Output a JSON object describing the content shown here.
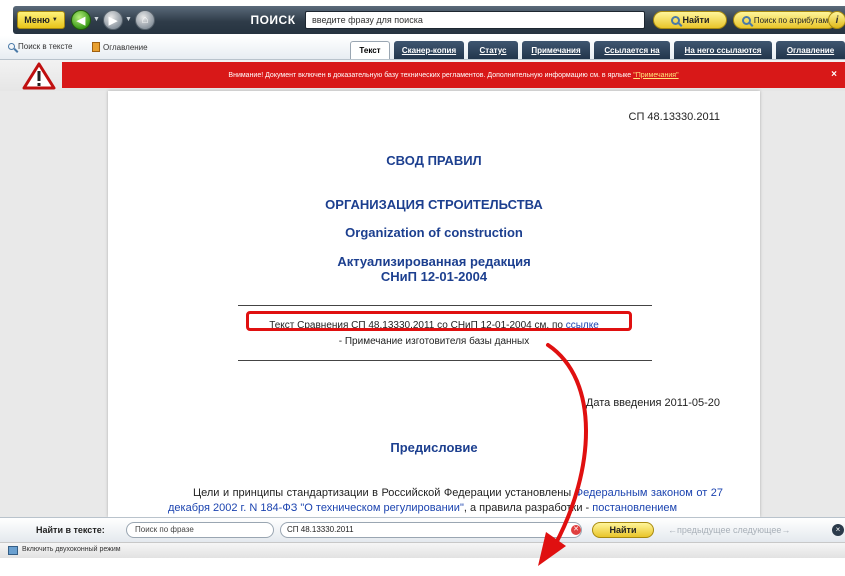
{
  "toolbar": {
    "menu_label": "Меню",
    "search_label": "ПОИСК",
    "search_placeholder": "введите фразу для поиска",
    "find_label": "Найти",
    "attr_search_label": "Поиск по атрибутам",
    "info_label": "i"
  },
  "secondary": {
    "search_in_text": "Поиск в тексте",
    "contents": "Оглавление",
    "tabs": [
      {
        "label": "Текст",
        "active": true
      },
      {
        "label": "Сканер-копия",
        "active": false
      },
      {
        "label": "Статус",
        "active": false
      },
      {
        "label": "Примечания",
        "active": false
      },
      {
        "label": "Ссылается на",
        "active": false
      },
      {
        "label": "На него ссылаются",
        "active": false
      },
      {
        "label": "Оглавление",
        "active": false
      }
    ]
  },
  "warning": {
    "text": "Внимание! Документ включен в доказательную базу технических регламентов. Дополнительную информацию см. в ярлыке",
    "link": "\"Примечания\"",
    "close": "×"
  },
  "document": {
    "code": "СП 48.13330.2011",
    "title1": "СВОД ПРАВИЛ",
    "title2": "ОРГАНИЗАЦИЯ СТРОИТЕЛЬСТВА",
    "title3": "Organization of construction",
    "title4": "Актуализированная редакция",
    "title5": "СНиП 12-01-2004",
    "comparison_text": "Текст Сравнения СП 48.13330.2011 со СНиП 12-01-2004 см. по",
    "comparison_link": "ссылке",
    "note": "- Примечание изготовителя базы данных",
    "date": "Дата введения 2011-05-20",
    "preface": "Предисловие",
    "para_start": "Цели и принципы стандартизации в Российской Федерации установлены",
    "para_link1": "Федеральным законом от 27 декабря 2002 г. N 184-ФЗ \"О техническом регулировании\"",
    "para_mid": ", а правила разработки -",
    "para_link2": "постановлением"
  },
  "findbar": {
    "label": "Найти в тексте:",
    "placeholder": "Поиск по фразе",
    "value": "СП 48.13330.2011",
    "go": "Найти",
    "prevnext": "←предыдущее следующее→",
    "close": "×"
  },
  "status": {
    "text": "Включить двухоконный режим"
  },
  "colors": {
    "warning_red": "#d81818",
    "heading_blue": "#1c3f8f",
    "annotation_red": "#e01010"
  }
}
